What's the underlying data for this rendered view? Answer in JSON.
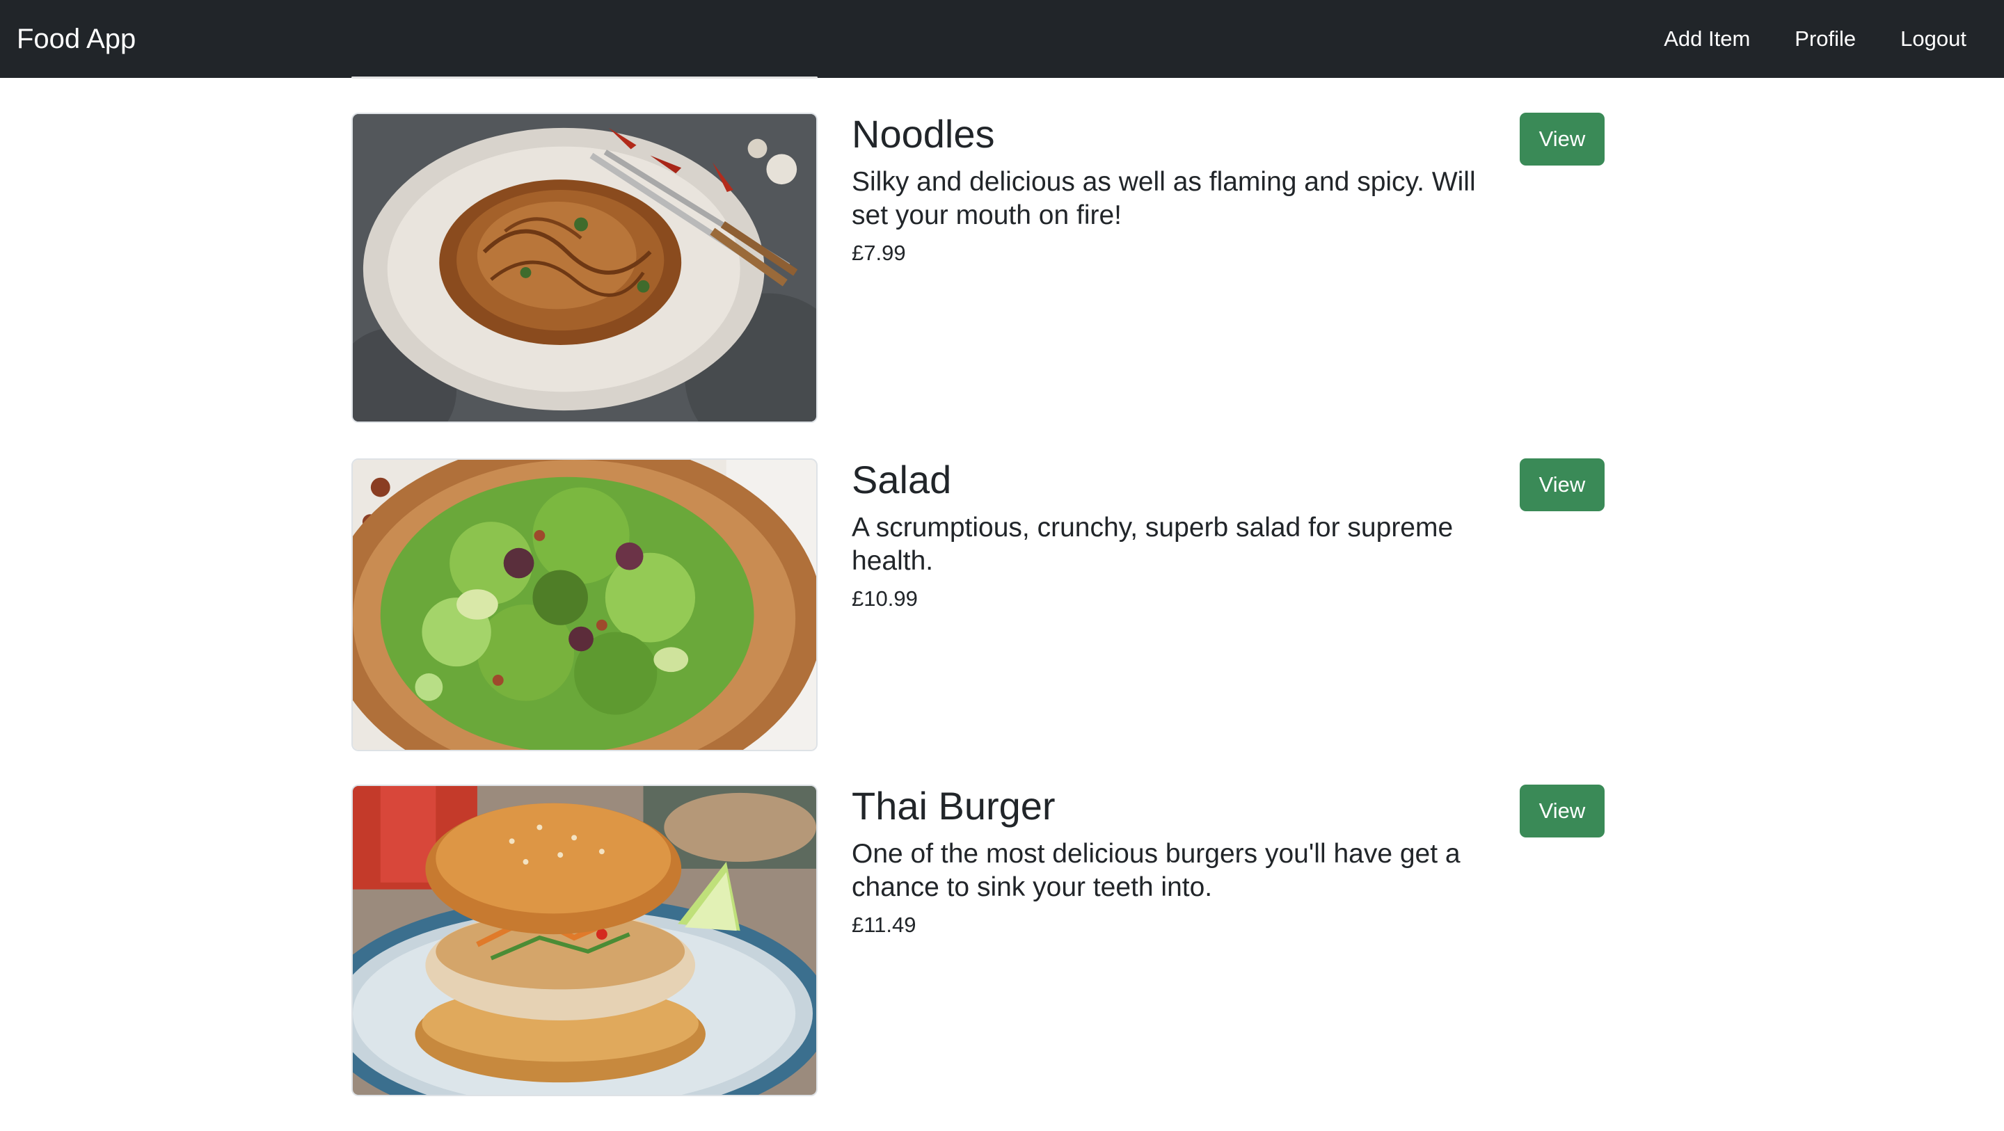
{
  "navbar": {
    "brand": "Food App",
    "links": [
      "Add Item",
      "Profile",
      "Logout"
    ],
    "background": "#212529"
  },
  "items": [
    {
      "title": "Noodles",
      "description": "Silky and delicious as well as flaming and spicy. Will set your mouth on fire!",
      "price": "£7.99",
      "button": "View",
      "image": "noodles-plate"
    },
    {
      "title": "Salad",
      "description": "A scrumptious, crunchy, superb salad for supreme health.",
      "price": "£10.99",
      "button": "View",
      "image": "green-salad-bowl"
    },
    {
      "title": "Thai Burger",
      "description": "One of the most delicious burgers you'll have get a chance to sink your teeth into.",
      "price": "£11.49",
      "button": "View",
      "image": "thai-burger-plate"
    }
  ],
  "colors": {
    "button": "#3a8a57",
    "text": "#212529"
  }
}
